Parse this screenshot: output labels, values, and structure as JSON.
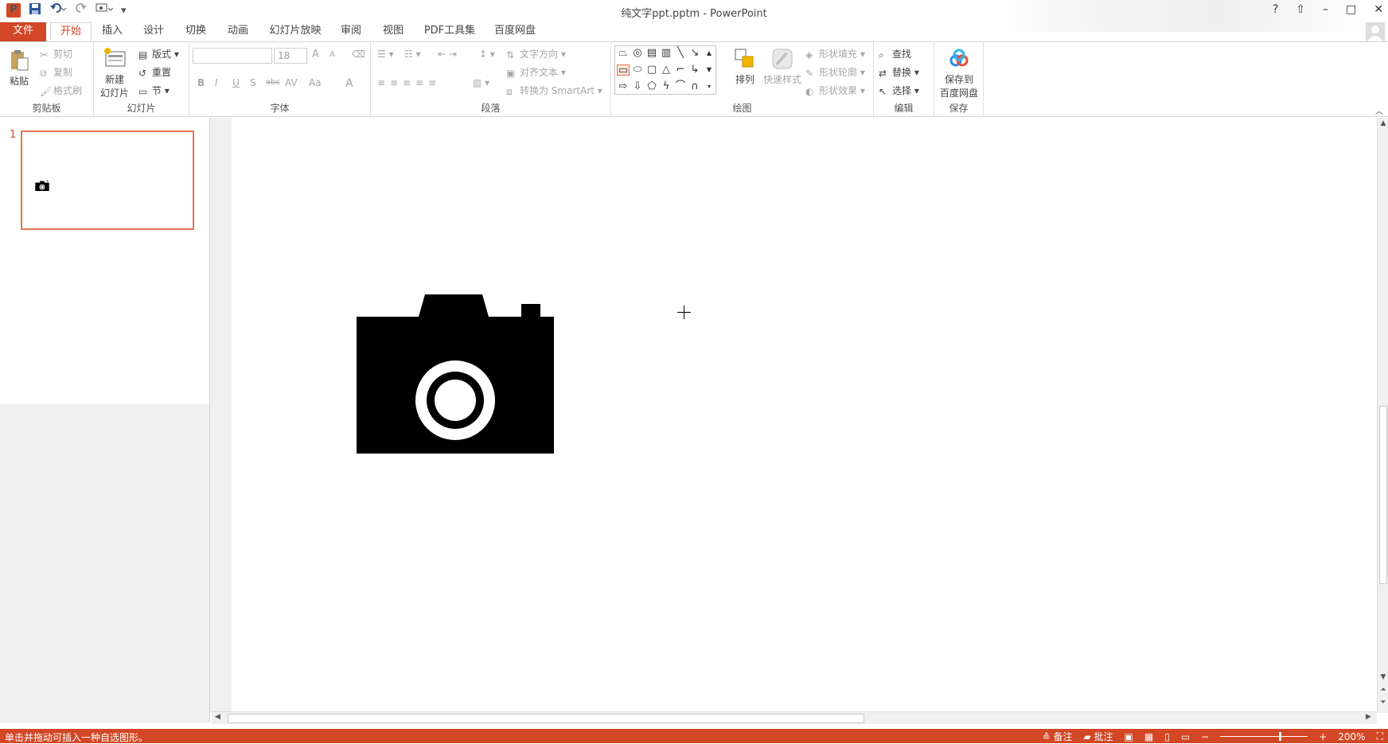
{
  "window": {
    "title": "纯文字ppt.pptm - PowerPoint",
    "help": "?",
    "restore_ribbon": "⇧",
    "minimize": "–",
    "maximize": "□",
    "close": "✕"
  },
  "qat": {
    "app_icon": "P",
    "save_icon": "save-icon",
    "undo_icon": "undo-icon",
    "redo_icon": "redo-icon",
    "present_icon": "present-icon",
    "customize": "▾"
  },
  "tabs": [
    {
      "label": "文件"
    },
    {
      "label": "开始"
    },
    {
      "label": "插入"
    },
    {
      "label": "设计"
    },
    {
      "label": "切换"
    },
    {
      "label": "动画"
    },
    {
      "label": "幻灯片放映"
    },
    {
      "label": "审阅"
    },
    {
      "label": "视图"
    },
    {
      "label": "PDF工具集"
    },
    {
      "label": "百度网盘"
    }
  ],
  "ribbon": {
    "clipboard": {
      "label": "剪贴板",
      "paste": "粘贴",
      "cut": "剪切",
      "copy": "复制",
      "format_painter": "格式刷"
    },
    "slides": {
      "label": "幻灯片",
      "new_slide_1": "新建",
      "new_slide_2": "幻灯片",
      "layout": "版式",
      "reset": "重置",
      "section": "节"
    },
    "font": {
      "label": "字体",
      "font_name": "",
      "font_size": "18",
      "bold": "B",
      "italic": "I",
      "underline": "U",
      "shadow": "S",
      "strike": "abc",
      "spacing": "AV",
      "case": "Aa",
      "color": "A",
      "grow": "A",
      "shrink": "A"
    },
    "paragraph": {
      "label": "段落",
      "text_direction": "文字方向",
      "align_text": "对齐文本",
      "smartart": "转换为 SmartArt"
    },
    "drawing": {
      "label": "绘图",
      "arrange": "排列",
      "quick_styles": "快速样式",
      "shape_fill": "形状填充",
      "shape_outline": "形状轮廓",
      "shape_effects": "形状效果"
    },
    "editing": {
      "label": "编辑",
      "find": "查找",
      "replace": "替换",
      "select": "选择"
    },
    "save": {
      "label": "保存",
      "save_to_1": "保存到",
      "save_to_2": "百度网盘"
    }
  },
  "slides_pane": {
    "slide_number": "1"
  },
  "status": {
    "message": "单击并拖动可插入一种自选图形。",
    "notes": "备注",
    "comments": "批注",
    "zoom_minus": "−",
    "zoom_plus": "+",
    "zoom": "200%"
  },
  "colors": {
    "accent": "#d24726",
    "thumb_border": "#e8734f"
  }
}
